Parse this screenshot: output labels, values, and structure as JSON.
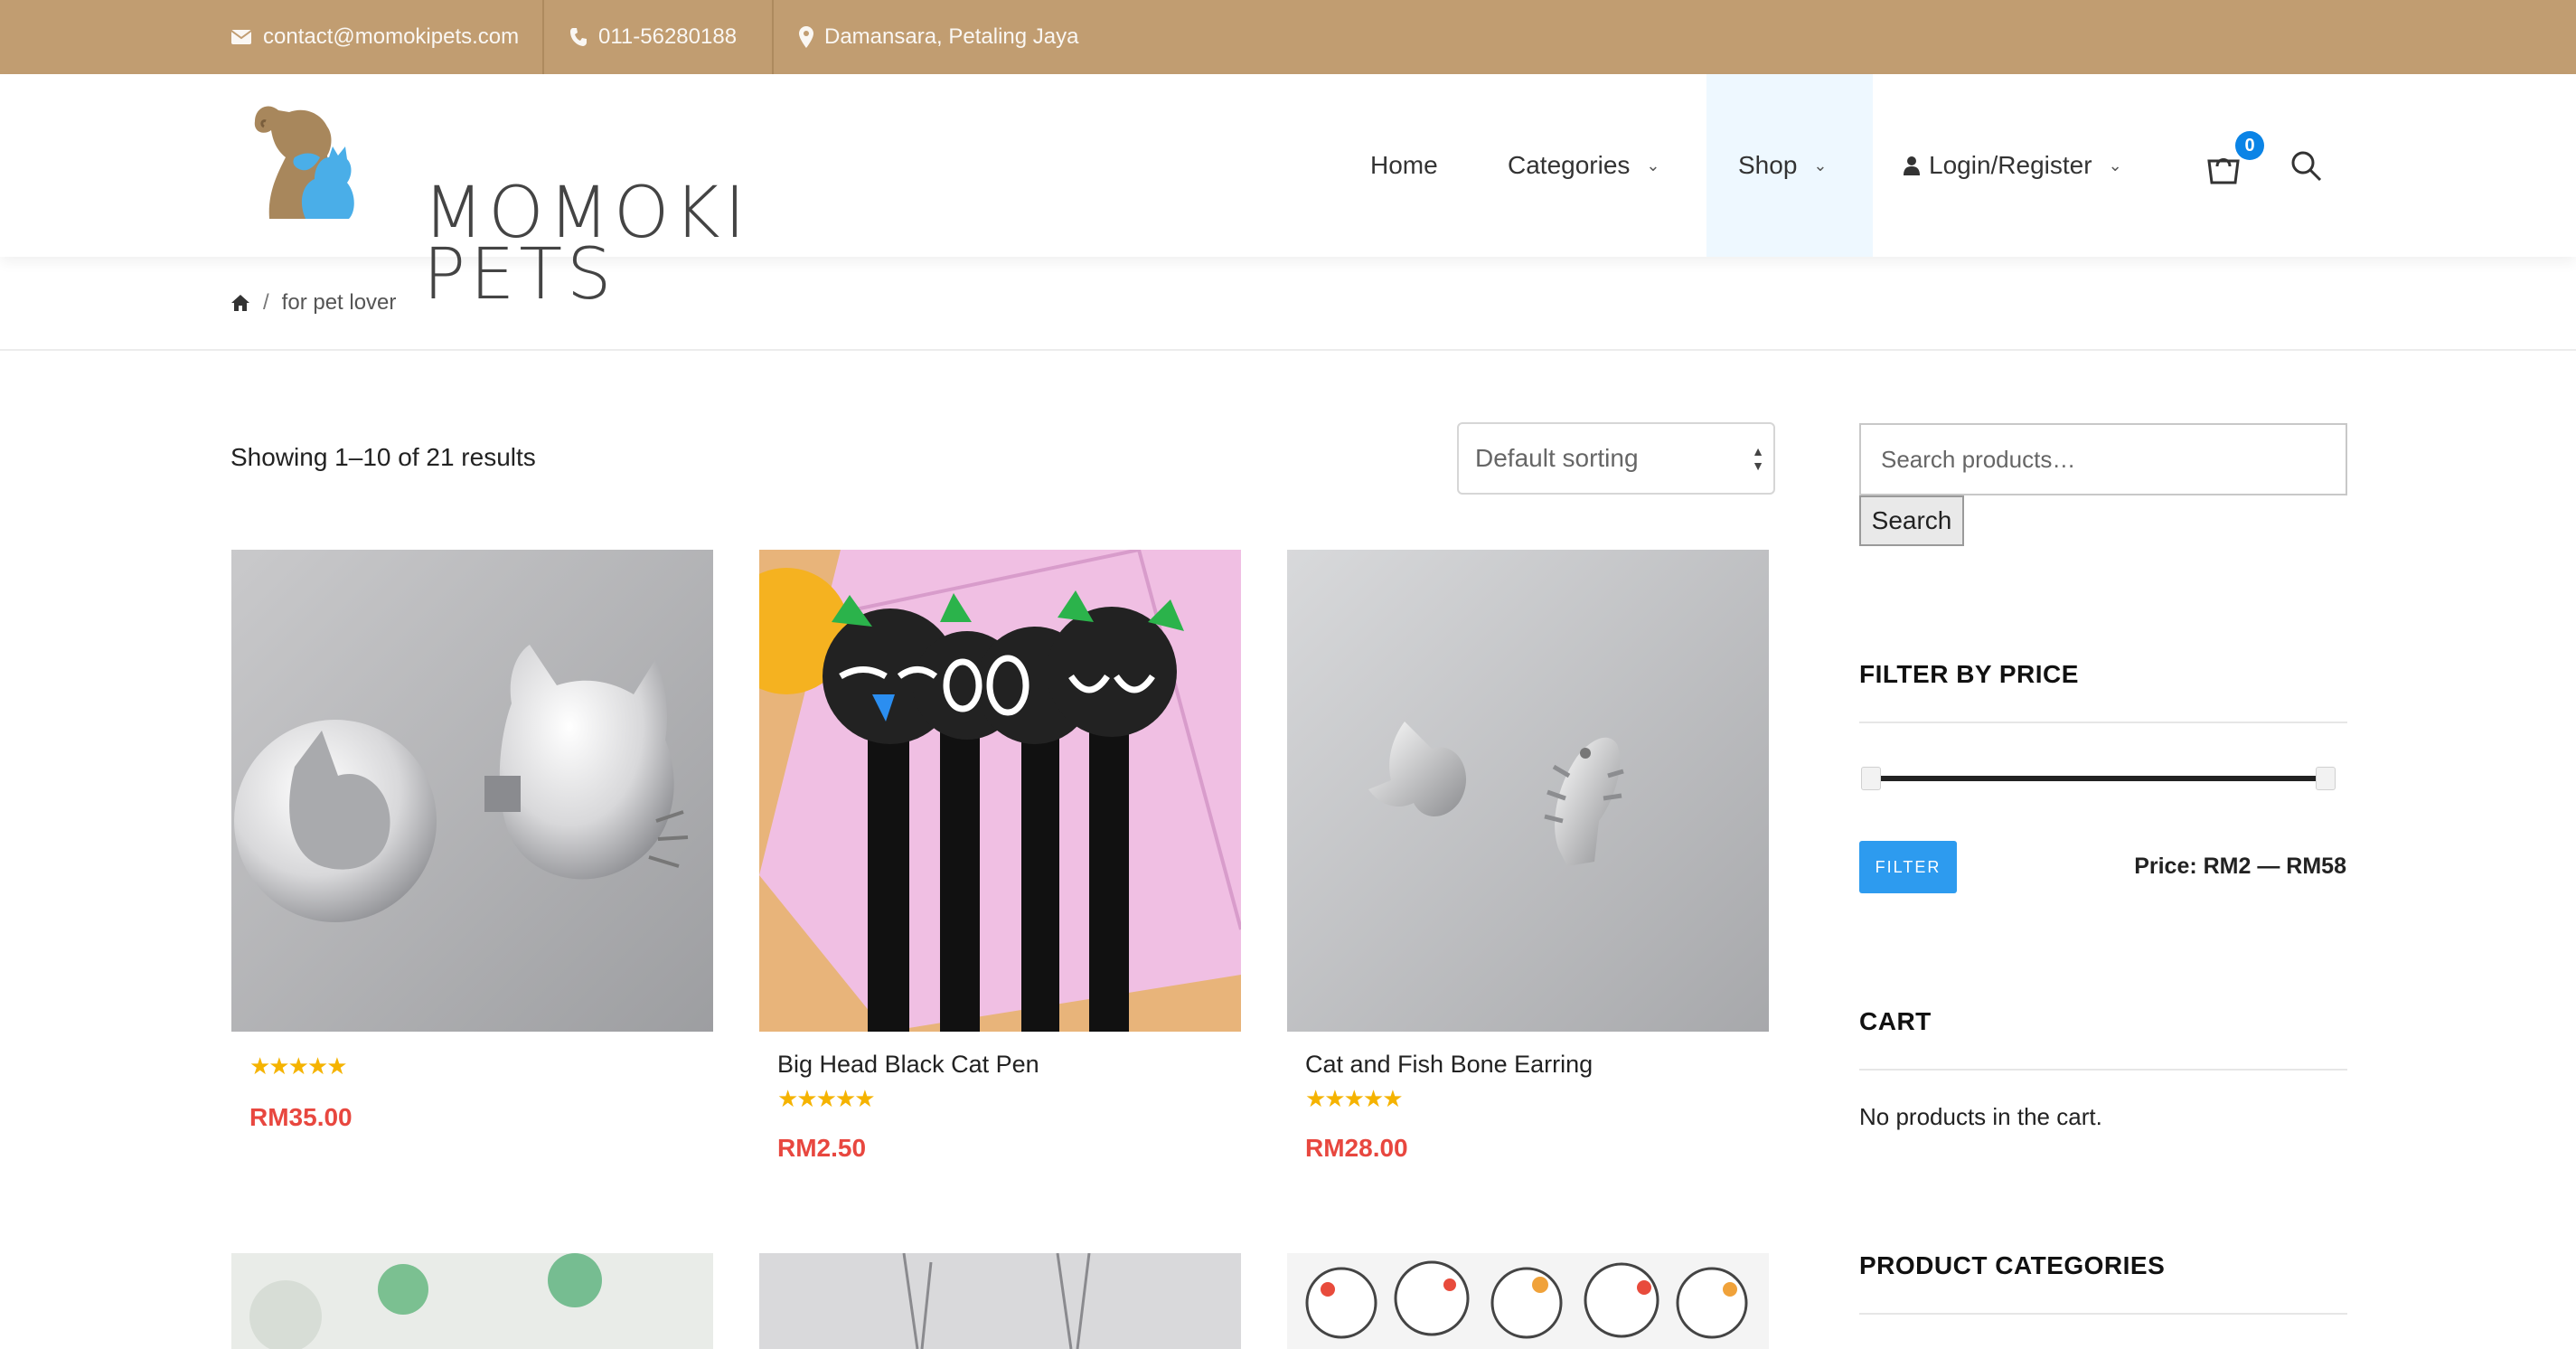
{
  "topbar": {
    "email": "contact@momokipets.com",
    "phone": "011-56280188",
    "location": "Damansara, Petaling Jaya"
  },
  "brand": {
    "line1": "MOMOKI",
    "line2": "PETS"
  },
  "nav": {
    "home": "Home",
    "categories": "Categories",
    "shop": "Shop",
    "login": "Login/Register",
    "cart_count": "0"
  },
  "breadcrumb": {
    "separator": "/",
    "current": "for pet lover"
  },
  "shop": {
    "results": "Showing 1–10 of 21 results",
    "sorting": "Default sorting"
  },
  "products": [
    {
      "name": "",
      "rating": 5.0,
      "stars": "★★★★★",
      "price": "RM35.00"
    },
    {
      "name": "Big Head Black Cat Pen",
      "rating": 4.5,
      "stars": "★★★★★",
      "price": "RM2.50"
    },
    {
      "name": "Cat and Fish Bone Earring",
      "rating": 4.5,
      "stars": "★★★★★",
      "price": "RM28.00"
    }
  ],
  "sidebar": {
    "search_placeholder": "Search products…",
    "search_button": "Search",
    "filter_title": "FILTER BY PRICE",
    "filter_button": "FILTER",
    "price_range": "Price: RM2 — RM58",
    "cart_title": "CART",
    "cart_empty": "No products in the cart.",
    "categories_title": "PRODUCT CATEGORIES"
  },
  "colors": {
    "topbar": "#c19d71",
    "price": "#e8473f",
    "accent": "#2d9bef",
    "star": "#f5b300"
  }
}
